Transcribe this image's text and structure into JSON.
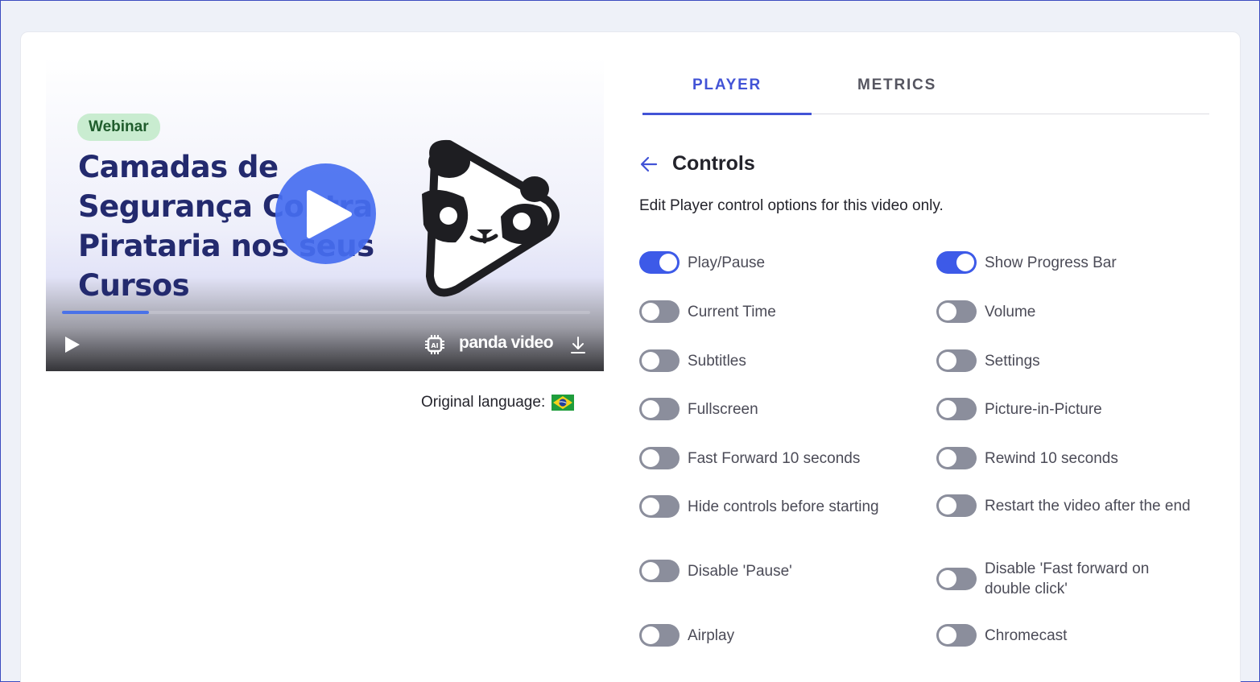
{
  "video": {
    "badge": "Webinar",
    "title": "Camadas de Segurança Contra Pirataria nos seus Cursos",
    "brand": "panda video",
    "progress_fraction": 0.165,
    "original_language_label": "Original language:",
    "language_flag": "brazil-flag"
  },
  "tabs": [
    {
      "label": "PLAYER",
      "active": true
    },
    {
      "label": "METRICS",
      "active": false
    }
  ],
  "controls": {
    "title": "Controls",
    "description": "Edit Player control options for this video only.",
    "options": [
      {
        "label": "Play/Pause",
        "on": true
      },
      {
        "label": "Show Progress Bar",
        "on": true
      },
      {
        "label": "Current Time",
        "on": false
      },
      {
        "label": "Volume",
        "on": false
      },
      {
        "label": "Subtitles",
        "on": false
      },
      {
        "label": "Settings",
        "on": false
      },
      {
        "label": "Fullscreen",
        "on": false
      },
      {
        "label": "Picture-in-Picture",
        "on": false
      },
      {
        "label": "Fast Forward 10 seconds",
        "on": false
      },
      {
        "label": "Rewind 10 seconds",
        "on": false
      },
      {
        "label": "Hide controls before starting",
        "on": false
      },
      {
        "label": "Restart the video after the end",
        "on": false
      },
      {
        "label": "Disable 'Pause'",
        "on": false
      },
      {
        "label": "Disable 'Fast forward on double click'",
        "on": false
      },
      {
        "label": "Airplay",
        "on": false
      },
      {
        "label": "Chromecast",
        "on": false
      }
    ]
  },
  "colors": {
    "accent": "#4253d6",
    "toggle_on": "#3d5ae8",
    "toggle_off": "#8b8e9c",
    "badge_bg": "#c9ecd0"
  }
}
